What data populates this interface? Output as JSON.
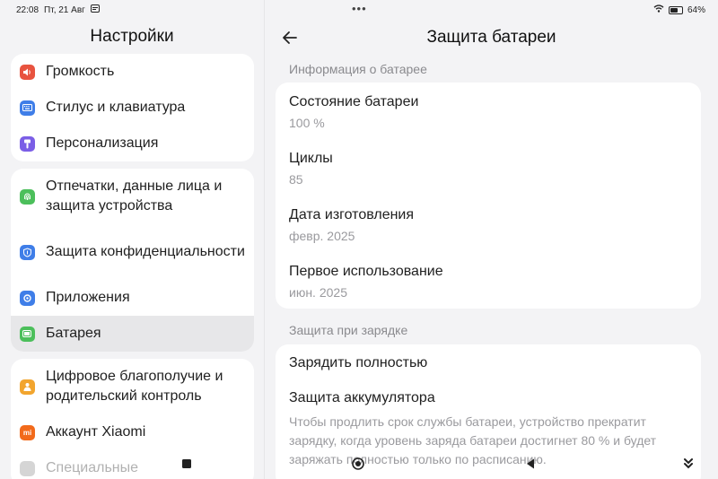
{
  "status_bar": {
    "time": "22:08",
    "date": "Пт, 21 Авг",
    "battery_percent": "64%",
    "battery_level": 0.64
  },
  "left": {
    "title": "Настройки",
    "groups": [
      {
        "items": [
          {
            "label": "Громкость",
            "icon": "speaker-icon",
            "color": "#e8533f"
          },
          {
            "label": "Стилус и клавиатура",
            "icon": "keyboard-icon",
            "color": "#3f7ee8"
          },
          {
            "label": "Персонализация",
            "icon": "brush-icon",
            "color": "#7b5ee6"
          }
        ]
      },
      {
        "items": [
          {
            "label": "Отпечатки, данные лица и защита устройства",
            "icon": "fingerprint-icon",
            "color": "#4cbf5b"
          },
          {
            "label": "Защита конфиденциальности",
            "icon": "privacy-shield-icon",
            "color": "#3f7ee8"
          },
          {
            "label": "Приложения",
            "icon": "apps-gear-icon",
            "color": "#3f7ee8"
          },
          {
            "label": "Батарея",
            "icon": "battery-icon",
            "color": "#4cbf5b",
            "selected": true
          }
        ]
      },
      {
        "items": [
          {
            "label": "Цифровое благополучие и родительский контроль",
            "icon": "wellbeing-icon",
            "color": "#f2a52e"
          },
          {
            "label": "Аккаунт Xiaomi",
            "icon": "xiaomi-icon",
            "color": "#f26a1b"
          },
          {
            "label": "Специальные",
            "icon": "accessibility-icon",
            "color": "#888888"
          }
        ]
      }
    ]
  },
  "right": {
    "title": "Защита батареи",
    "info_section": "Информация о батарее",
    "info_rows": [
      {
        "title": "Состояние батареи",
        "value": "100 %"
      },
      {
        "title": "Циклы",
        "value": "85"
      },
      {
        "title": "Дата изготовления",
        "value": "февр. 2025"
      },
      {
        "title": "Первое использование",
        "value": "июн. 2025"
      }
    ],
    "charge_section": "Защита при зарядке",
    "charge_full": "Зарядить полностью",
    "protect_title": "Защита аккумулятора",
    "protect_desc": "Чтобы продлить срок службы батареи, устройство прекратит зарядку, когда уровень заряда батареи достигнет 80 % и будет заряжать полностью только по расписанию."
  }
}
